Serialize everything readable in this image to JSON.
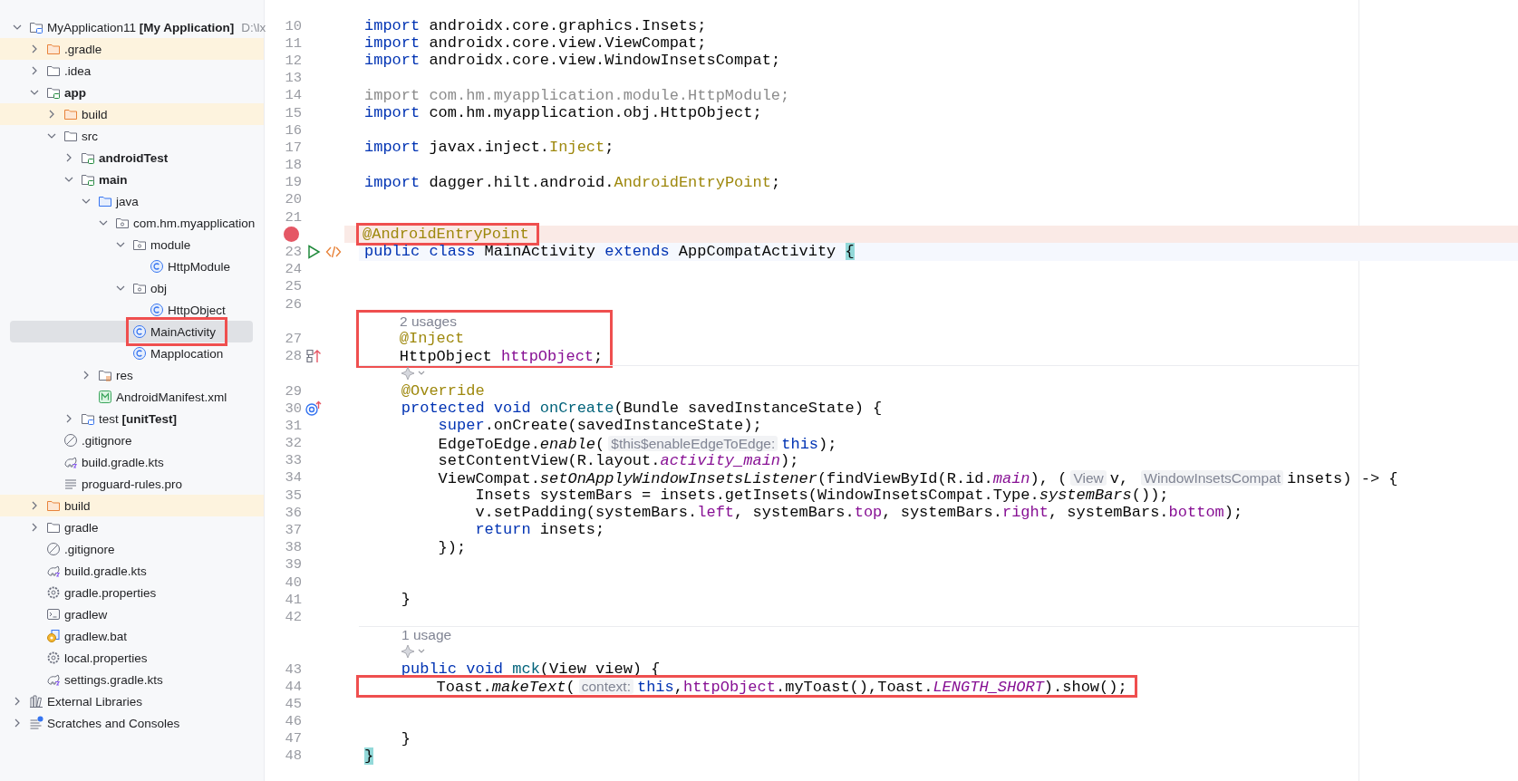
{
  "project_tree": {
    "items": [
      {
        "label": "MyApplication11 **[My Application]**",
        "path": "D:\\lx",
        "kind": "project",
        "expanded": true,
        "children": [
          {
            "label": ".gradle",
            "kind": "folder",
            "excluded": true,
            "expanded": false
          },
          {
            "label": ".idea",
            "kind": "folder",
            "excluded": false,
            "expanded": false
          },
          {
            "label": "app",
            "bold": true,
            "kind": "module",
            "expanded": true,
            "children": [
              {
                "label": "build",
                "kind": "folder",
                "excluded": true,
                "expanded": false
              },
              {
                "label": "src",
                "kind": "folder",
                "excluded": false,
                "expanded": true,
                "children": [
                  {
                    "label": "androidTest",
                    "bold": true,
                    "kind": "module",
                    "expanded": false
                  },
                  {
                    "label": "main",
                    "bold": true,
                    "kind": "module",
                    "expanded": true,
                    "children": [
                      {
                        "label": "java",
                        "kind": "source",
                        "expanded": true,
                        "children": [
                          {
                            "label": "com.hm.myapplication",
                            "kind": "package",
                            "expanded": true,
                            "children": [
                              {
                                "label": "module",
                                "kind": "package",
                                "expanded": true,
                                "children": [
                                  {
                                    "label": "HttpModule",
                                    "kind": "class",
                                    "selected": false
                                  }
                                ]
                              },
                              {
                                "label": "obj",
                                "kind": "package",
                                "expanded": true,
                                "children": [
                                  {
                                    "label": "HttpObject",
                                    "kind": "class",
                                    "selected": false
                                  }
                                ]
                              },
                              {
                                "label": "MainActivity",
                                "kind": "class",
                                "selected": true,
                                "annotated": true
                              },
                              {
                                "label": "Mapplocation",
                                "kind": "class",
                                "selected": false
                              }
                            ]
                          }
                        ]
                      },
                      {
                        "label": "res",
                        "kind": "res",
                        "expanded": false
                      },
                      {
                        "label": "AndroidManifest.xml",
                        "kind": "manifest",
                        "selected": false
                      }
                    ]
                  },
                  {
                    "label": "test **[unitTest]**",
                    "kind": "test-module",
                    "expanded": false
                  }
                ]
              },
              {
                "label": ".gitignore",
                "kind": "ignore",
                "selected": false
              },
              {
                "label": "build.gradle.kts",
                "kind": "gradle",
                "selected": false
              },
              {
                "label": "proguard-rules.pro",
                "kind": "text",
                "selected": false
              }
            ]
          },
          {
            "label": "build",
            "kind": "folder",
            "excluded": true,
            "expanded": false
          },
          {
            "label": "gradle",
            "kind": "folder",
            "excluded": false,
            "expanded": false
          },
          {
            "label": ".gitignore",
            "kind": "ignore",
            "selected": false
          },
          {
            "label": "build.gradle.kts",
            "kind": "gradle",
            "selected": false
          },
          {
            "label": "gradle.properties",
            "kind": "settings",
            "selected": false
          },
          {
            "label": "gradlew",
            "kind": "terminal",
            "selected": false
          },
          {
            "label": "gradlew.bat",
            "kind": "bat",
            "selected": false
          },
          {
            "label": "local.properties",
            "kind": "settings",
            "selected": false
          },
          {
            "label": "settings.gradle.kts",
            "kind": "gradle",
            "selected": false
          }
        ]
      },
      {
        "label": "External Libraries",
        "kind": "libraries",
        "expanded": false
      },
      {
        "label": "Scratches and Consoles",
        "kind": "scratches",
        "expanded": false
      }
    ]
  },
  "editor": {
    "rows": [
      {
        "kind": "code",
        "number": "10",
        "tokens": [
          {
            "kind": "kw",
            "text": "import"
          },
          {
            "kind": "plain",
            "text": " androidx.core.graphics.Insets;"
          }
        ]
      },
      {
        "kind": "code",
        "number": "11",
        "tokens": [
          {
            "kind": "kw",
            "text": "import"
          },
          {
            "kind": "plain",
            "text": " androidx.core.view.ViewCompat;"
          }
        ]
      },
      {
        "kind": "code",
        "number": "12",
        "tokens": [
          {
            "kind": "kw",
            "text": "import"
          },
          {
            "kind": "plain",
            "text": " androidx.core.view.WindowInsetsCompat;"
          }
        ]
      },
      {
        "kind": "code",
        "number": "13"
      },
      {
        "kind": "code",
        "number": "14",
        "tokens": [
          {
            "kind": "unused",
            "text": "import com.hm.myapplication.module.HttpModule;"
          }
        ]
      },
      {
        "kind": "code",
        "number": "15",
        "tokens": [
          {
            "kind": "kw",
            "text": "import"
          },
          {
            "kind": "plain",
            "text": " com.hm.myapplication.obj.HttpObject;"
          }
        ]
      },
      {
        "kind": "code",
        "number": "16"
      },
      {
        "kind": "code",
        "number": "17",
        "tokens": [
          {
            "kind": "kw",
            "text": "import"
          },
          {
            "kind": "plain",
            "text": " javax.inject."
          },
          {
            "kind": "ann",
            "text": "Inject"
          },
          {
            "kind": "plain",
            "text": ";"
          }
        ]
      },
      {
        "kind": "code",
        "number": "18"
      },
      {
        "kind": "code",
        "number": "19",
        "tokens": [
          {
            "kind": "kw",
            "text": "import"
          },
          {
            "kind": "plain",
            "text": " dagger.hilt.android."
          },
          {
            "kind": "ann",
            "text": "AndroidEntryPoint"
          },
          {
            "kind": "plain",
            "text": ";"
          }
        ]
      },
      {
        "kind": "code",
        "number": "20"
      },
      {
        "kind": "code",
        "number": "21"
      },
      {
        "kind": "code",
        "breakpoint": true,
        "annotated": true,
        "tokens": [
          {
            "kind": "ann",
            "text": "@AndroidEntryPoint"
          }
        ]
      },
      {
        "kind": "code",
        "number": "23",
        "caret": true,
        "gutter_icons": [
          {
            "kind": "run"
          },
          {
            "kind": "markup"
          }
        ],
        "tokens": [
          {
            "kind": "kw",
            "text": "public class"
          },
          {
            "kind": "plain",
            "text": " MainActivity "
          },
          {
            "kind": "kw",
            "text": "extends"
          },
          {
            "kind": "plain",
            "text": " AppCompatActivity "
          },
          {
            "kind": "brace",
            "text": "{"
          }
        ]
      },
      {
        "kind": "code",
        "number": "24"
      },
      {
        "kind": "code",
        "number": "25"
      },
      {
        "kind": "code",
        "number": "26"
      },
      {
        "kind": "usages",
        "text": "2 usages",
        "annotated": true
      },
      {
        "kind": "code",
        "number": "27",
        "annotated": true,
        "tokens": [
          {
            "kind": "ann",
            "text": "    @Inject"
          }
        ]
      },
      {
        "kind": "code",
        "number": "28",
        "annotated": true,
        "gutter_icons": [
          {
            "kind": "implemented"
          }
        ],
        "tokens": [
          {
            "kind": "plain",
            "text": "    HttpObject "
          },
          {
            "kind": "field",
            "text": "httpObject"
          },
          {
            "kind": "plain",
            "text": ";"
          }
        ]
      },
      {
        "kind": "ai",
        "separator": true
      },
      {
        "kind": "code",
        "number": "29",
        "tokens": [
          {
            "kind": "ann",
            "text": "    @Override"
          }
        ]
      },
      {
        "kind": "code",
        "number": "30",
        "gutter_icons": [
          {
            "kind": "overrides"
          }
        ],
        "tokens": [
          {
            "kind": "kw",
            "text": "    protected void "
          },
          {
            "kind": "decl",
            "text": "onCreate"
          },
          {
            "kind": "plain",
            "text": "(Bundle savedInstanceState) {"
          }
        ]
      },
      {
        "kind": "code",
        "number": "31",
        "tokens": [
          {
            "kind": "kw",
            "text": "        super"
          },
          {
            "kind": "plain",
            "text": ".onCreate(savedInstanceState);"
          }
        ]
      },
      {
        "kind": "code",
        "number": "32",
        "tokens": [
          {
            "kind": "plain",
            "text": "        EdgeToEdge."
          },
          {
            "kind": "italic",
            "text": "enable"
          },
          {
            "kind": "plain",
            "text": "("
          },
          {
            "kind": "hint",
            "text": "$this$enableEdgeToEdge:"
          },
          {
            "kind": "kw",
            "text": "this"
          },
          {
            "kind": "plain",
            "text": ");"
          }
        ]
      },
      {
        "kind": "code",
        "number": "33",
        "tokens": [
          {
            "kind": "plain",
            "text": "        setContentView(R.layout."
          },
          {
            "kind": "static",
            "text": "activity_main"
          },
          {
            "kind": "plain",
            "text": ");"
          }
        ]
      },
      {
        "kind": "code",
        "number": "34",
        "tokens": [
          {
            "kind": "plain",
            "text": "        ViewCompat."
          },
          {
            "kind": "italic",
            "text": "setOnApplyWindowInsetsListener"
          },
          {
            "kind": "plain",
            "text": "(findViewById(R.id."
          },
          {
            "kind": "static",
            "text": "main"
          },
          {
            "kind": "plain",
            "text": "), ("
          },
          {
            "kind": "hint",
            "text": "View"
          },
          {
            "kind": "plain",
            "text": "v, "
          },
          {
            "kind": "hint",
            "text": "WindowInsetsCompat"
          },
          {
            "kind": "plain",
            "text": "insets) -> {"
          }
        ]
      },
      {
        "kind": "code",
        "number": "35",
        "tokens": [
          {
            "kind": "plain",
            "text": "            Insets systemBars = insets.getInsets(WindowInsetsCompat.Type."
          },
          {
            "kind": "italic",
            "text": "systemBars"
          },
          {
            "kind": "plain",
            "text": "());"
          }
        ]
      },
      {
        "kind": "code",
        "number": "36",
        "tokens": [
          {
            "kind": "plain",
            "text": "            v.setPadding(systemBars."
          },
          {
            "kind": "field",
            "text": "left"
          },
          {
            "kind": "plain",
            "text": ", systemBars."
          },
          {
            "kind": "field",
            "text": "top"
          },
          {
            "kind": "plain",
            "text": ", systemBars."
          },
          {
            "kind": "field",
            "text": "right"
          },
          {
            "kind": "plain",
            "text": ", systemBars."
          },
          {
            "kind": "field",
            "text": "bottom"
          },
          {
            "kind": "plain",
            "text": ");"
          }
        ]
      },
      {
        "kind": "code",
        "number": "37",
        "tokens": [
          {
            "kind": "kw",
            "text": "            return"
          },
          {
            "kind": "plain",
            "text": " insets;"
          }
        ]
      },
      {
        "kind": "code",
        "number": "38",
        "tokens": [
          {
            "kind": "plain",
            "text": "        });"
          }
        ]
      },
      {
        "kind": "code",
        "number": "39"
      },
      {
        "kind": "code",
        "number": "40"
      },
      {
        "kind": "code",
        "number": "41",
        "tokens": [
          {
            "kind": "plain",
            "text": "    }"
          }
        ]
      },
      {
        "kind": "code",
        "number": "42"
      },
      {
        "kind": "usages",
        "text": "1 usage",
        "separator": true
      },
      {
        "kind": "ai"
      },
      {
        "kind": "code",
        "number": "43",
        "tokens": [
          {
            "kind": "kw",
            "text": "    public void "
          },
          {
            "kind": "decl",
            "text": "mck"
          },
          {
            "kind": "plain",
            "text": "(View view) {"
          }
        ]
      },
      {
        "kind": "code",
        "number": "44",
        "annotated": true,
        "tokens": [
          {
            "kind": "plain",
            "text": "        Toast."
          },
          {
            "kind": "italic",
            "text": "makeText"
          },
          {
            "kind": "plain",
            "text": "("
          },
          {
            "kind": "hint",
            "text": "context:"
          },
          {
            "kind": "kw",
            "text": "this"
          },
          {
            "kind": "plain",
            "text": ","
          },
          {
            "kind": "field",
            "text": "httpObject"
          },
          {
            "kind": "plain",
            "text": ".myToast(),Toast."
          },
          {
            "kind": "static",
            "text": "LENGTH_SHORT"
          },
          {
            "kind": "plain",
            "text": ").show();"
          }
        ]
      },
      {
        "kind": "code",
        "number": "45"
      },
      {
        "kind": "code",
        "number": "46"
      },
      {
        "kind": "code",
        "number": "47",
        "tokens": [
          {
            "kind": "plain",
            "text": "    }"
          }
        ]
      },
      {
        "kind": "code",
        "number": "48",
        "tokens": [
          {
            "kind": "brace",
            "text": "}"
          }
        ]
      }
    ]
  }
}
